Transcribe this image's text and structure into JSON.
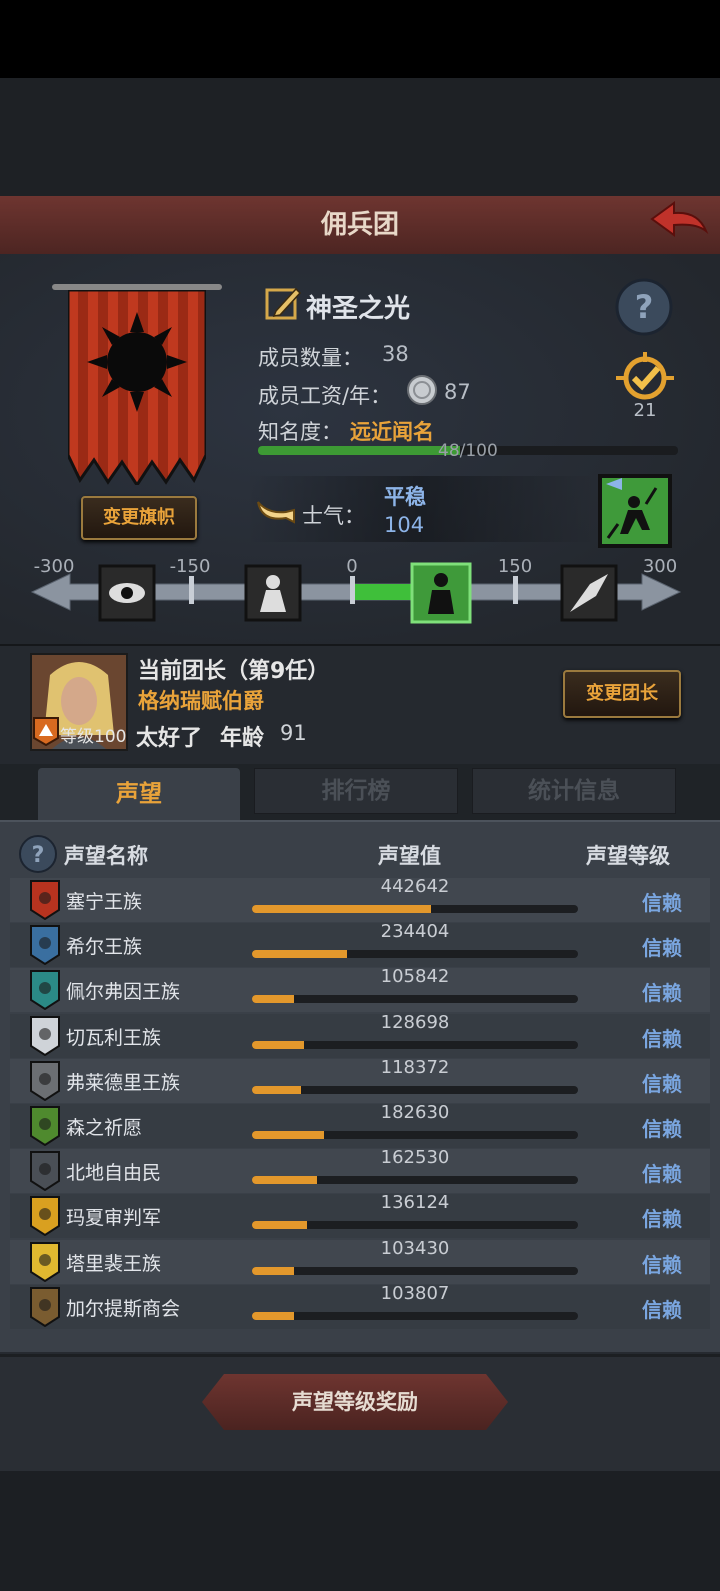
{
  "header": {
    "title": "佣兵团"
  },
  "guild": {
    "name": "神圣之光",
    "members_label": "成员数量：",
    "members_value": "38",
    "salary_label": "成员工资/年：",
    "salary_value": "87",
    "fame_label": "知名度：",
    "fame_level": "远近闻名",
    "fame_progress_text": "48/100",
    "fame_progress": 0.48,
    "mission_count": "21",
    "change_banner_label": "变更旗帜"
  },
  "morale": {
    "label": "士气：",
    "status": "平稳",
    "value": "104",
    "scale_ticks": [
      "-300",
      "-150",
      "0",
      "150",
      "300"
    ],
    "scale_value": 104
  },
  "leader": {
    "title": "当前团长（第9任）",
    "name": "格纳瑞赋伯爵",
    "level_text": "等级100",
    "trait": "太好了",
    "age_label": "年龄",
    "age": "91",
    "change_button": "变更团长"
  },
  "tabs": [
    {
      "label": "声望",
      "active": true
    },
    {
      "label": "排行榜",
      "active": false
    },
    {
      "label": "统计信息",
      "active": false
    }
  ],
  "reputation_table": {
    "headers": {
      "name": "声望名称",
      "value": "声望值",
      "level": "声望等级"
    },
    "rows": [
      {
        "name": "塞宁王族",
        "value": "442642",
        "fill": 0.55,
        "level": "信赖",
        "icon": "crest-red-icon"
      },
      {
        "name": "希尔王族",
        "value": "234404",
        "fill": 0.29,
        "level": "信赖",
        "icon": "crest-blue-icon"
      },
      {
        "name": "佩尔弗因王族",
        "value": "105842",
        "fill": 0.13,
        "level": "信赖",
        "icon": "crest-teal-icon"
      },
      {
        "name": "切瓦利王族",
        "value": "128698",
        "fill": 0.16,
        "level": "信赖",
        "icon": "crest-white-icon"
      },
      {
        "name": "弗莱德里王族",
        "value": "118372",
        "fill": 0.15,
        "level": "信赖",
        "icon": "crest-grey-icon"
      },
      {
        "name": "森之祈愿",
        "value": "182630",
        "fill": 0.22,
        "level": "信赖",
        "icon": "crest-green-icon"
      },
      {
        "name": "北地自由民",
        "value": "162530",
        "fill": 0.2,
        "level": "信赖",
        "icon": "crest-dark-icon"
      },
      {
        "name": "玛夏审判军",
        "value": "136124",
        "fill": 0.17,
        "level": "信赖",
        "icon": "crest-yellow-icon"
      },
      {
        "name": "塔里裴王族",
        "value": "103430",
        "fill": 0.13,
        "level": "信赖",
        "icon": "crest-gold-icon"
      },
      {
        "name": "加尔提斯商会",
        "value": "103807",
        "fill": 0.13,
        "level": "信赖",
        "icon": "crest-chest-icon"
      }
    ]
  },
  "footer": {
    "reward_button": "声望等级奖励"
  }
}
